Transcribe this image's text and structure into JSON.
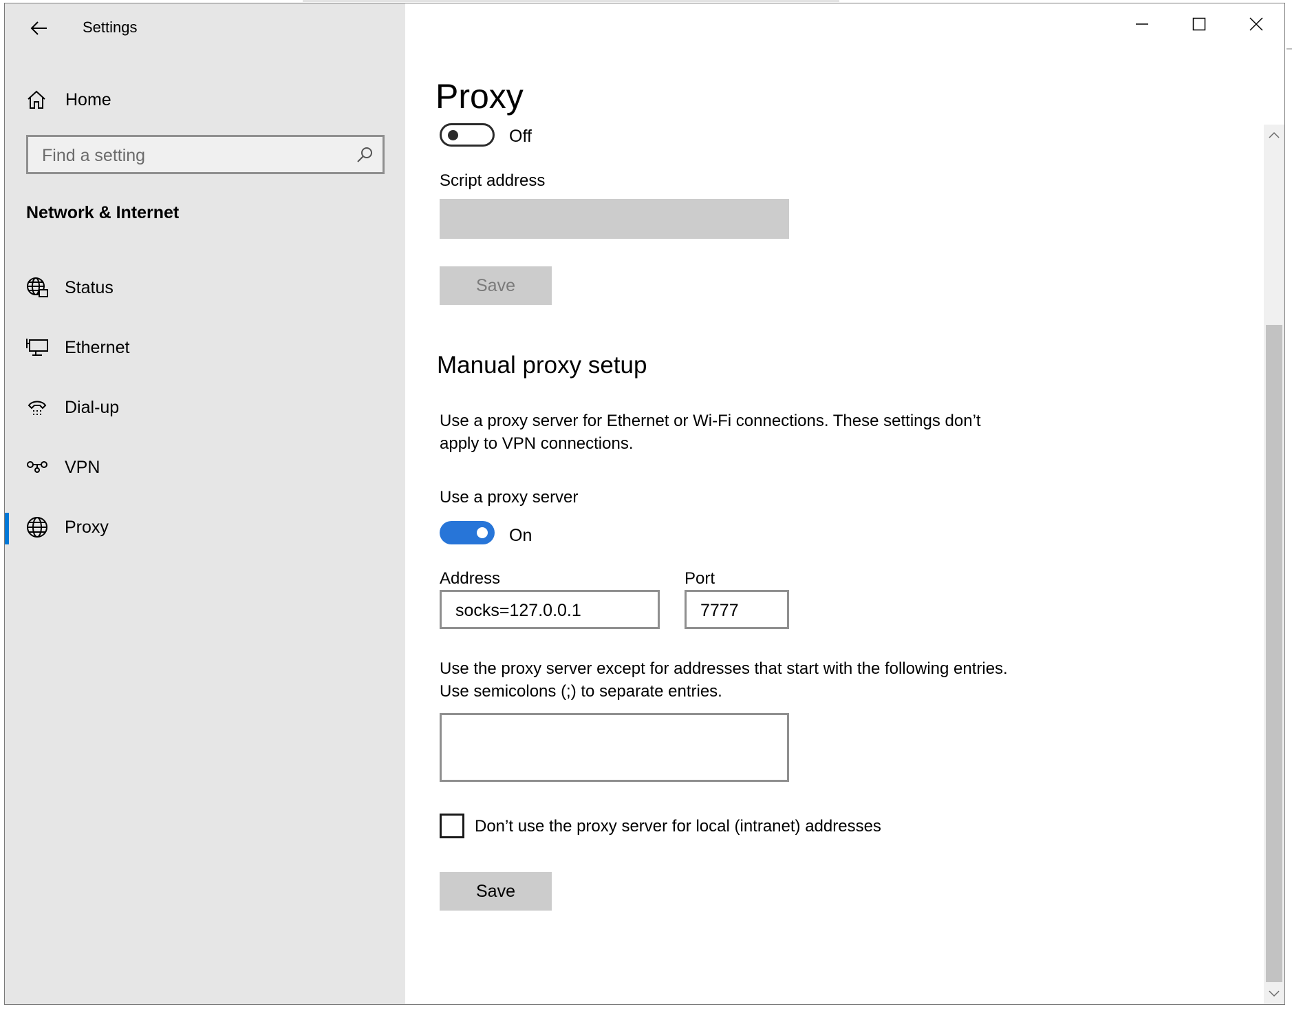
{
  "window": {
    "title": "Settings",
    "controls": {
      "minimize": "minimize-icon",
      "maximize": "maximize-icon",
      "close": "close-icon"
    }
  },
  "sidebar": {
    "home_label": "Home",
    "search_placeholder": "Find a setting",
    "section_title": "Network & Internet",
    "items": [
      {
        "label": "Status",
        "icon": "status-globe-icon"
      },
      {
        "label": "Ethernet",
        "icon": "ethernet-icon"
      },
      {
        "label": "Dial-up",
        "icon": "dial-up-icon"
      },
      {
        "label": "VPN",
        "icon": "vpn-icon"
      },
      {
        "label": "Proxy",
        "icon": "proxy-globe-icon",
        "active": true
      }
    ]
  },
  "main": {
    "title": "Proxy",
    "setup_script": {
      "toggle_state": "Off",
      "script_address_label": "Script address",
      "script_address_value": "",
      "save_label": "Save"
    },
    "manual": {
      "heading": "Manual proxy setup",
      "description": "Use a proxy server for Ethernet or Wi-Fi connections. These settings don’t apply to VPN connections.",
      "use_proxy_label": "Use a proxy server",
      "toggle_state": "On",
      "address_label": "Address",
      "address_value": "socks=127.0.0.1",
      "port_label": "Port",
      "port_value": "7777",
      "exceptions_description": "Use the proxy server except for addresses that start with the following entries. Use semicolons (;) to separate entries.",
      "exceptions_value": "",
      "local_checkbox_label": "Don’t use the proxy server for local (intranet) addresses",
      "local_checkbox_checked": false,
      "save_label": "Save"
    }
  },
  "colors": {
    "sidebar_bg": "#e6e6e6",
    "accent": "#2775d8",
    "button_bg": "#cccccc"
  }
}
